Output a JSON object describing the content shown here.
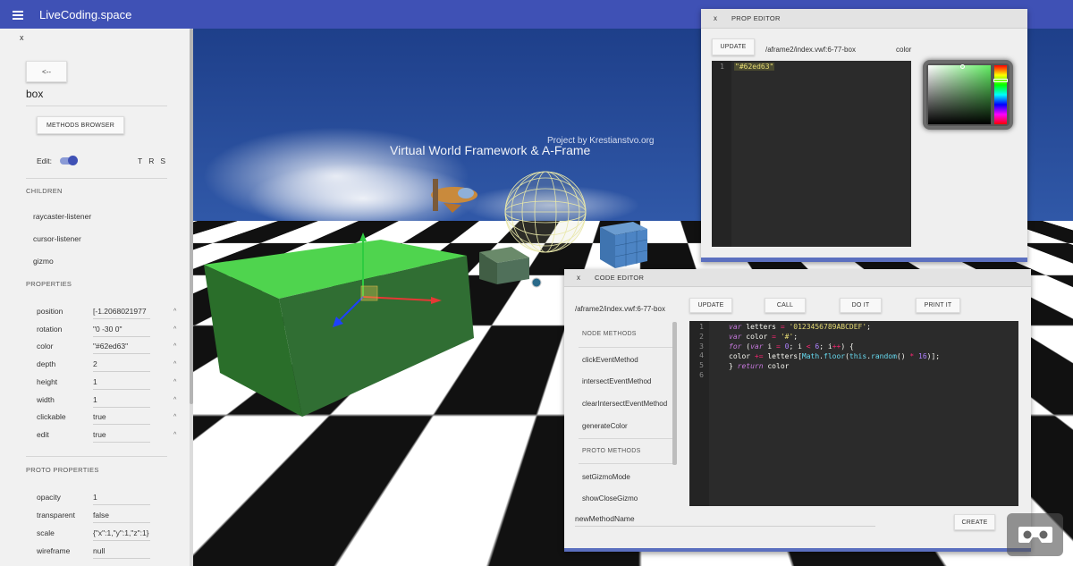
{
  "app": {
    "title": "LiveCoding.space"
  },
  "scene": {
    "caption": "Virtual World Framework & A-Frame",
    "credit": "Project by Krestianstvo.org"
  },
  "inspector": {
    "close_label": "x",
    "back_label": "<--",
    "node_name": "box",
    "methods_browser_label": "METHODS BROWSER",
    "edit_label": "Edit:",
    "edit_on": true,
    "trs": [
      "T",
      "R",
      "S"
    ],
    "children_header": "CHILDREN",
    "children": [
      "raycaster-listener",
      "cursor-listener",
      "gizmo"
    ],
    "properties_header": "PROPERTIES",
    "properties": [
      {
        "key": "position",
        "value": "[-1.2068021977"
      },
      {
        "key": "rotation",
        "value": "\"0 -30 0\""
      },
      {
        "key": "color",
        "value": "\"#62ed63\""
      },
      {
        "key": "depth",
        "value": "2"
      },
      {
        "key": "height",
        "value": "1"
      },
      {
        "key": "width",
        "value": "1"
      },
      {
        "key": "clickable",
        "value": "true"
      },
      {
        "key": "edit",
        "value": "true"
      }
    ],
    "proto_header": "PROTO PROPERTIES",
    "proto_properties": [
      {
        "key": "opacity",
        "value": "1"
      },
      {
        "key": "transparent",
        "value": "false"
      },
      {
        "key": "scale",
        "value": "{\"x\":1,\"y\":1,\"z\":1}"
      },
      {
        "key": "wireframe",
        "value": "null"
      }
    ],
    "caret": "^"
  },
  "prop_editor": {
    "close_label": "x",
    "title": "PROP EDITOR",
    "update_label": "UPDATE",
    "path": "/aframe2/index.vwf:6-77-box",
    "prop_name": "color",
    "line_number": "1",
    "value": "\"#62ed63\"",
    "color_value": "#62ed63"
  },
  "code_editor": {
    "close_label": "x",
    "title": "CODE EDITOR",
    "path": "/aframe2/index.vwf:6-77-box",
    "buttons": {
      "update": "UPDATE",
      "call": "CALL",
      "doit": "DO IT",
      "printit": "PRINT IT",
      "create": "CREATE"
    },
    "node_methods_header": "NODE METHODS",
    "node_methods": [
      "clickEventMethod",
      "intersectEventMethod",
      "clearIntersectEventMethod",
      "generateColor"
    ],
    "proto_methods_header": "PROTO METHODS",
    "proto_methods": [
      "setGizmoMode",
      "showCloseGizmo"
    ],
    "line_numbers": [
      "1",
      "2",
      "3",
      "4",
      "5",
      "6"
    ],
    "new_method_placeholder": "newMethodName"
  }
}
